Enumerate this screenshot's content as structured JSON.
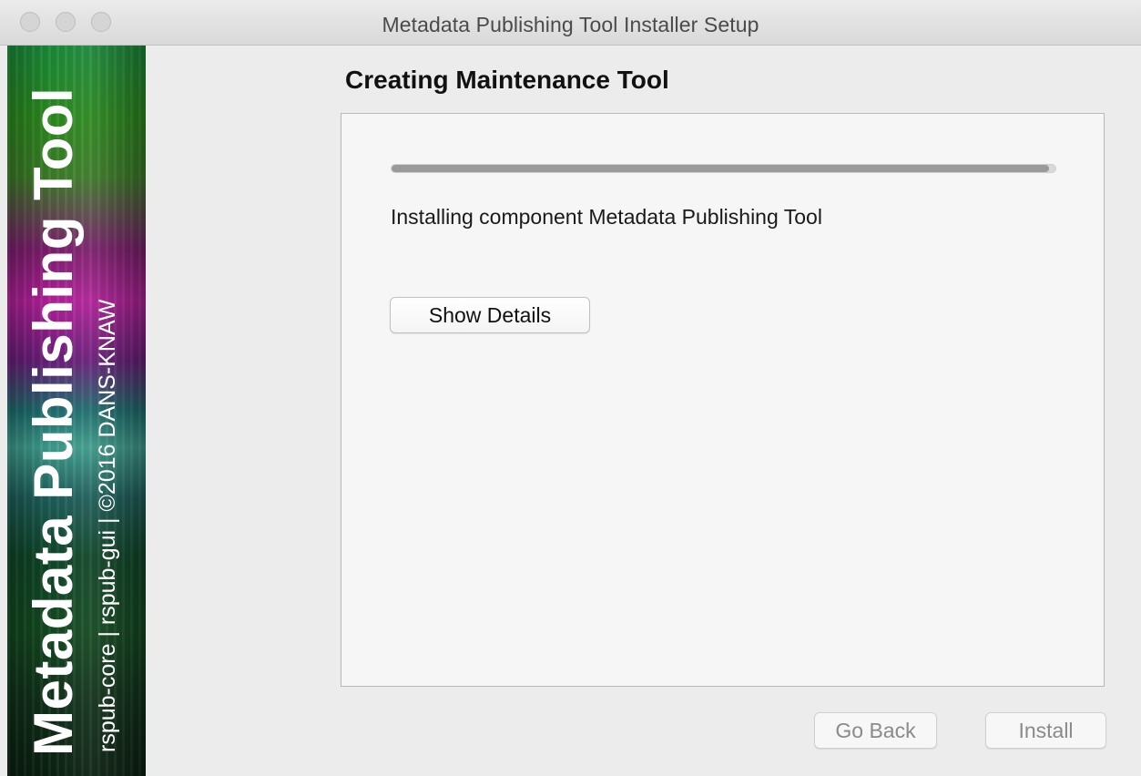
{
  "window": {
    "title": "Metadata Publishing Tool Installer Setup"
  },
  "banner": {
    "title": "Metadata Publishing Tool",
    "subtitle": "rspub-core | rspub-gui | ©2016 DANS-KNAW"
  },
  "page": {
    "title": "Creating Maintenance Tool"
  },
  "progress": {
    "fraction": 0.99,
    "status_text": "Installing component Metadata Publishing Tool"
  },
  "buttons": {
    "show_details": "Show Details",
    "go_back": "Go Back",
    "install": "Install"
  },
  "icons": {
    "close": "traffic-light-close-icon",
    "minimize": "traffic-light-minimize-icon",
    "zoom": "traffic-light-zoom-icon"
  },
  "colors": {
    "progress_fill": "#9a9a9a",
    "disabled_text": "#8a8a8a"
  }
}
